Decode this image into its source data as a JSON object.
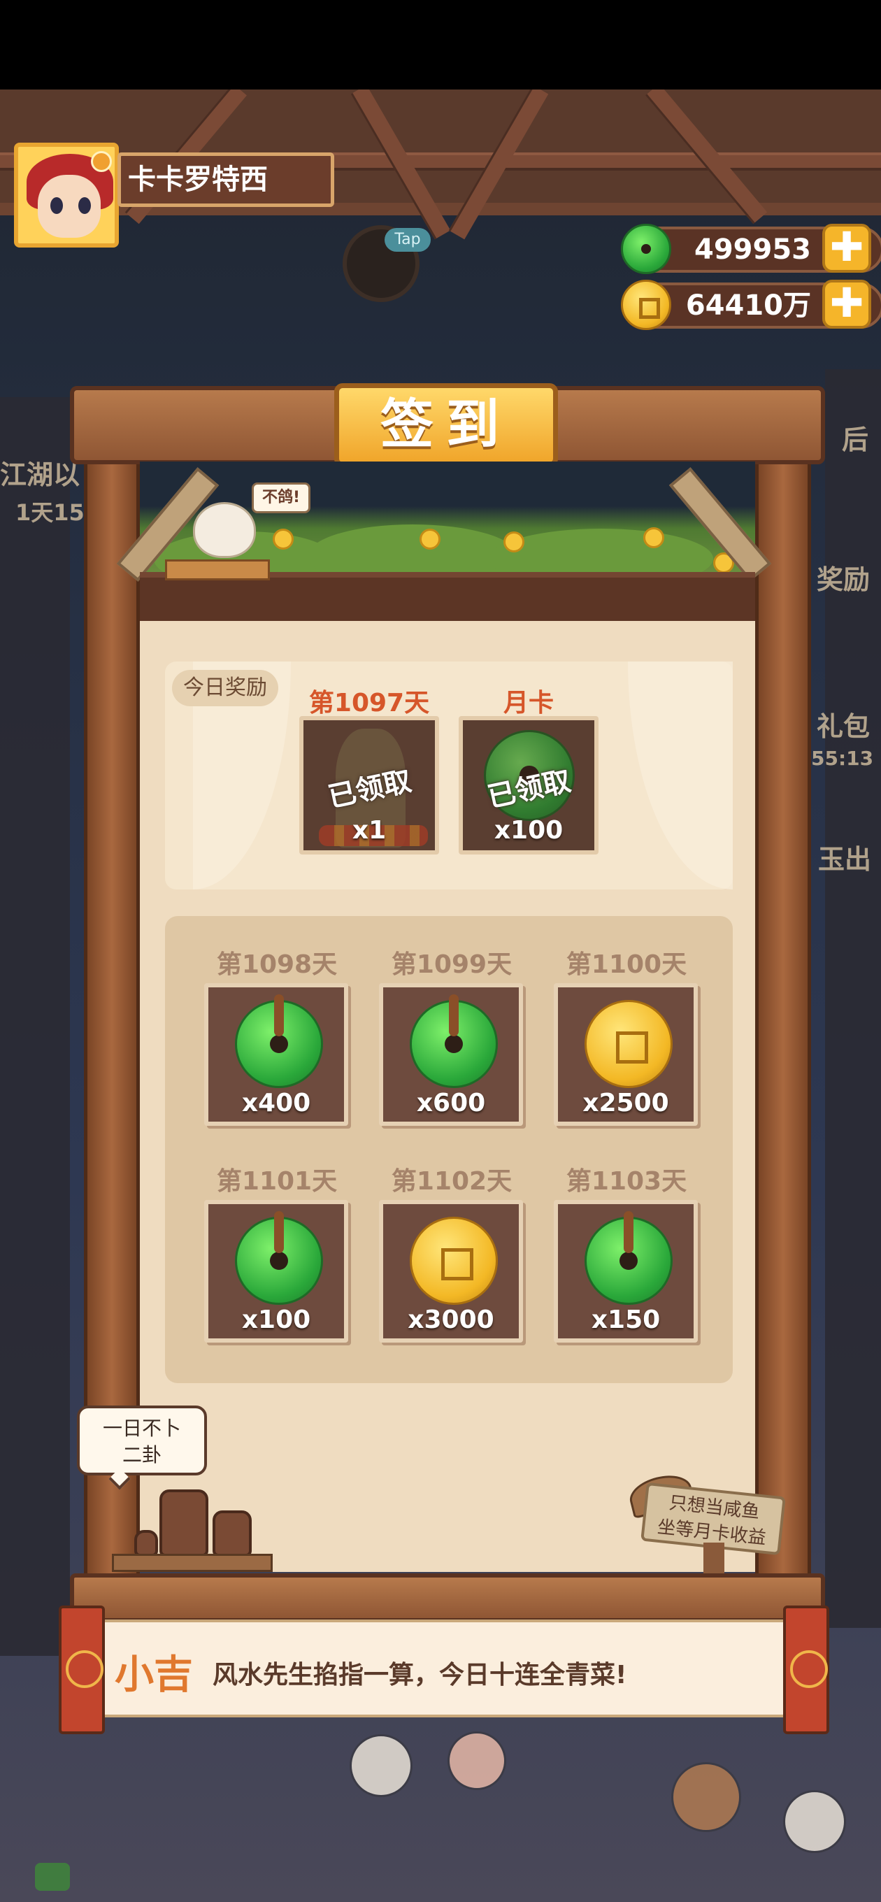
{
  "player": {
    "name": "卡卡罗特西",
    "tap_label": "Tap"
  },
  "currency": {
    "jade_amount": "499953",
    "coin_amount": "64410万",
    "plus_label": "✚"
  },
  "side": {
    "left_text_1": "江湖以",
    "left_text_2": "1天15",
    "right_text_1": "奖励",
    "right_text_2": "礼包",
    "right_text_3": "55:13",
    "right_text_4": "玉出",
    "right_text_5": "后"
  },
  "board": {
    "title": "签到",
    "bird_bubble": "不鸽!"
  },
  "today": {
    "tag": "今日奖励",
    "items": [
      {
        "heading": "第1097天",
        "status": "已领取",
        "qty": "x1",
        "icon": "statue-icon"
      },
      {
        "heading": "月卡",
        "status": "已领取",
        "qty": "x100",
        "icon": "jade-icon"
      }
    ]
  },
  "upcoming": [
    {
      "day": "第1098天",
      "qty": "x400",
      "icon": "jade-icon"
    },
    {
      "day": "第1099天",
      "qty": "x600",
      "icon": "jade-icon"
    },
    {
      "day": "第1100天",
      "qty": "x2500",
      "icon": "coin-icon"
    },
    {
      "day": "第1101天",
      "qty": "x100",
      "icon": "jade-icon"
    },
    {
      "day": "第1102天",
      "qty": "x3000",
      "icon": "coin-icon"
    },
    {
      "day": "第1103天",
      "qty": "x150",
      "icon": "jade-icon"
    }
  ],
  "deco": {
    "speech_line1": "一日不卜",
    "speech_line2": "二卦",
    "sign_line1": "只想当咸鱼",
    "sign_line2": "坐等月卡收益"
  },
  "dialog": {
    "speaker": "小吉",
    "text": "风水先生掐指一算，今日十连全青菜!"
  },
  "colors": {
    "accent_orange": "#e0782e",
    "heading_red": "#d6562a",
    "panel_bg": "#efdcc0",
    "wood": "#8f5634"
  }
}
